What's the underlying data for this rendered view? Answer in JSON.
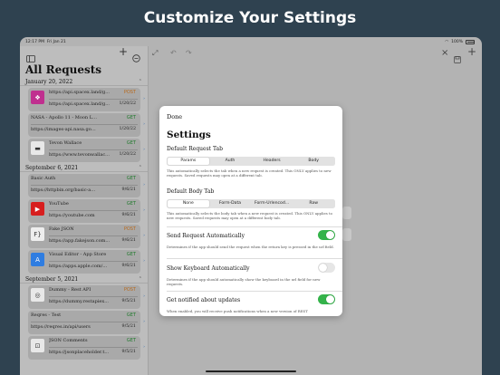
{
  "headline": "Customize Your Settings",
  "status": {
    "time": "12:17 PM",
    "date": "Fri Jan 21",
    "battery": "100%"
  },
  "sidebar": {
    "title": "All Requests",
    "sections": [
      {
        "date": "January 20, 2022",
        "items": [
          {
            "name": "https://api.spacex.land/g...",
            "method": "POST",
            "url": "https://api.spacex.land/g...",
            "date": "1/20/22",
            "thumb_color": "#c0308f",
            "thumb_icon": "❖"
          },
          {
            "name": "NASA - Apollo 11 - Moon Landi...",
            "method": "GET",
            "url": "https://images-api.nasa.gov/se...",
            "date": "1/20/22",
            "thumb_color": "",
            "thumb_icon": ""
          },
          {
            "name": "Tevon Wallace",
            "method": "GET",
            "url": "https://www.tevonwallac...",
            "date": "1/20/22",
            "thumb_color": "#e8e8e8",
            "thumb_icon": "▬"
          }
        ]
      },
      {
        "date": "September 6, 2021",
        "items": [
          {
            "name": "Basic Auth",
            "method": "GET",
            "url": "https://httpbin.org/basic-auth/f...",
            "date": "9/6/21",
            "thumb_color": "",
            "thumb_icon": ""
          },
          {
            "name": "YouTube",
            "method": "GET",
            "url": "https://youtube.com",
            "date": "9/6/21",
            "thumb_color": "#d71e1e",
            "thumb_icon": "▶"
          },
          {
            "name": "Fake JSON",
            "method": "POST",
            "url": "https://app.fakejson.com...",
            "date": "9/6/21",
            "thumb_color": "#eeeeee",
            "thumb_icon": "F}"
          },
          {
            "name": "Visual Editor - App Store",
            "method": "GET",
            "url": "https://apps.apple.com/...",
            "date": "9/6/21",
            "thumb_color": "#2f7de1",
            "thumb_icon": "A"
          }
        ]
      },
      {
        "date": "September 5, 2021",
        "items": [
          {
            "name": "Dummy - Rest API",
            "method": "POST",
            "url": "https://dummy.restapiex...",
            "date": "9/5/21",
            "thumb_color": "#e8e8e8",
            "thumb_icon": "◎"
          },
          {
            "name": "Reqres - Test",
            "method": "GET",
            "url": "https://reqres.in/api/users",
            "date": "9/5/21",
            "thumb_color": "",
            "thumb_icon": ""
          },
          {
            "name": "JSON Comments",
            "method": "GET",
            "url": "https://jsonplaceholder.t...",
            "date": "9/5/21",
            "thumb_color": "#e8e8e8",
            "thumb_icon": "⊡"
          }
        ]
      }
    ]
  },
  "modal": {
    "done": "Done",
    "title": "Settings",
    "request_tab": {
      "label": "Default Request Tab",
      "options": [
        "Params",
        "Auth",
        "Headers",
        "Body"
      ],
      "selected": "Params",
      "desc": "This automatically selects the tab when a new request is created. This ONLY applies to new requests. Saved requests may open at a different tab."
    },
    "body_tab": {
      "label": "Default Body Tab",
      "options": [
        "None",
        "Form-Data",
        "Form-Urlencod...",
        "Raw"
      ],
      "selected": "None",
      "desc": "This automatically selects the body tab when a new request is created. This ONLY applies to new requests. Saved requests may open at a different body tab."
    },
    "send_auto": {
      "label": "Send Request Automatically",
      "on": true,
      "desc": "Determines if the app should send the request when the return key is pressed in the url field."
    },
    "keyboard_auto": {
      "label": "Show Keyboard Automatically",
      "on": false,
      "desc": "Determines if the app should automatically show the keyboard in the url field for new requests."
    },
    "notify": {
      "label": "Get notified about updates",
      "on": true,
      "desc": "When enabled, you will receive push notifications when a new version of REST"
    }
  },
  "colors": {
    "get": "#1f7a2c",
    "post": "#b86a1d",
    "toggle_on": "#34b34a",
    "background": "#2f4250"
  }
}
